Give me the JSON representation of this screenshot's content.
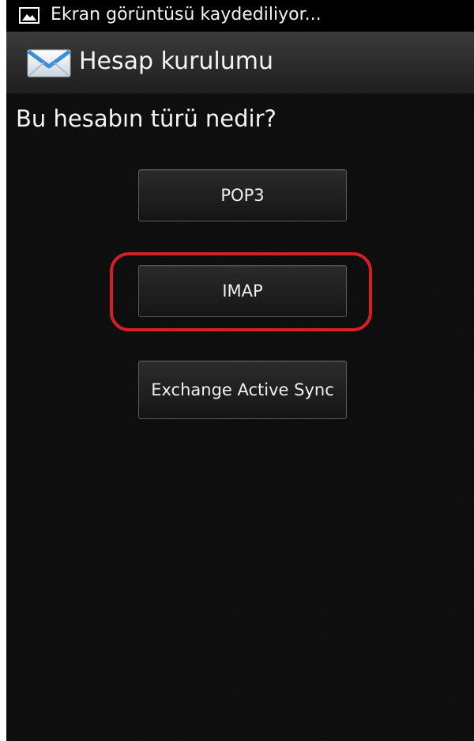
{
  "status_bar": {
    "notification_text": "Ekran görüntüsü kaydediliyor...",
    "icon": "image-icon"
  },
  "header": {
    "icon": "mail-icon",
    "title": "Hesap kurulumu"
  },
  "main": {
    "question": "Bu hesabın türü nedir?",
    "options": [
      {
        "label": "POP3"
      },
      {
        "label": "IMAP",
        "highlighted": true
      },
      {
        "label": "Exchange Active Sync"
      }
    ],
    "highlight_color": "#d31f2a"
  }
}
